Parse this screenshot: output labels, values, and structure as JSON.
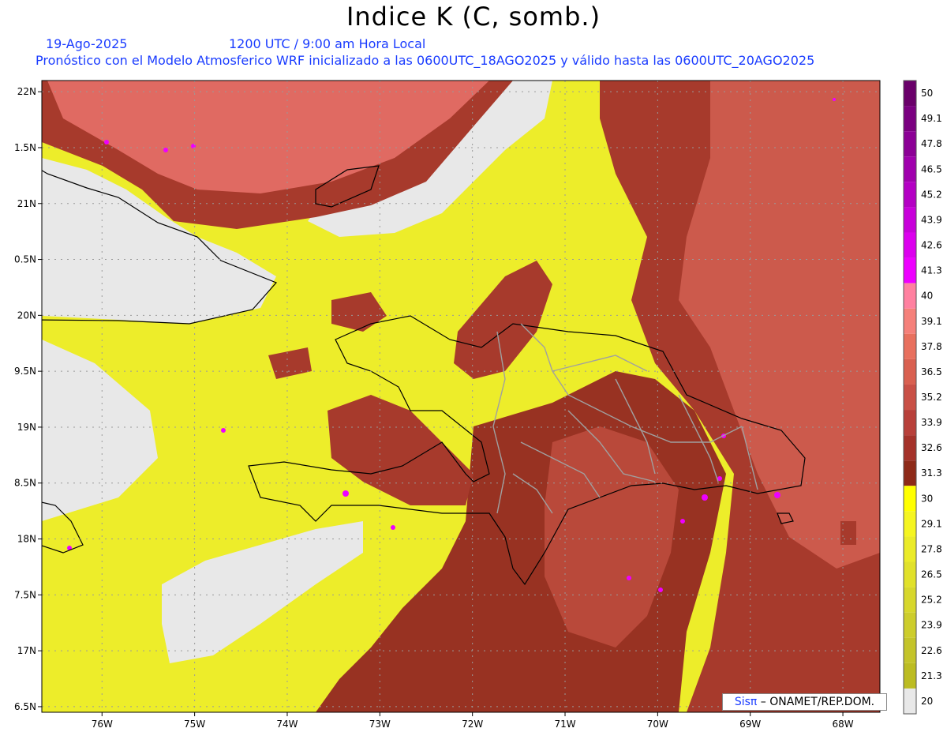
{
  "title": "Indice K (C, somb.)",
  "date": "19-Ago-2025",
  "time": "1200 UTC / 9:00 am Hora Local",
  "model_line": "Pronóstico con el Modelo Atmosferico WRF inicializado a las 0600UTC_18AGO2025 y válido hasta las  0600UTC_20AGO2025",
  "credit": {
    "brand": "Sisπ",
    "org": " – ONAMET/REP.DOM."
  },
  "map": {
    "lat_labels": [
      "22N",
      "1.5N",
      "21N",
      "0.5N",
      "20N",
      "9.5N",
      "19N",
      "8.5N",
      "18N",
      "7.5N",
      "17N",
      "6.5N"
    ],
    "lat_values": [
      22,
      21.5,
      21,
      20.5,
      20,
      19.5,
      19,
      18.5,
      18,
      17.5,
      17,
      16.5
    ],
    "lon_labels": [
      "76W",
      "75W",
      "74W",
      "73W",
      "72W",
      "71W",
      "70W",
      "69W",
      "68W"
    ],
    "lon_values": [
      -76,
      -75,
      -74,
      -73,
      -72,
      -71,
      -70,
      -69,
      -68
    ],
    "lon_range": [
      -76.65,
      -67.6
    ],
    "lat_range": [
      16.45,
      22.1
    ],
    "colors": {
      "land_masked": "#e8e8e8",
      "grid": "#9a9a9a",
      "coast": "#000000",
      "borders": "#a0a0a0"
    }
  },
  "colorbar": {
    "labels": [
      "50",
      "49.1",
      "47.8",
      "46.5",
      "45.2",
      "43.9",
      "42.6",
      "41.3",
      "40",
      "39.1",
      "37.8",
      "36.5",
      "35.2",
      "33.9",
      "32.6",
      "31.3",
      "30",
      "29.1",
      "27.8",
      "26.5",
      "25.2",
      "23.9",
      "22.6",
      "21.3",
      "20"
    ],
    "colors": [
      "#6a006a",
      "#7a0080",
      "#8c0096",
      "#a000ad",
      "#b400c4",
      "#c800da",
      "#dc00ee",
      "#ee00ff",
      "#ff80a0",
      "#f5807a",
      "#e8705e",
      "#d96050",
      "#c95046",
      "#b8403a",
      "#a5322a",
      "#8e2a18",
      "#ffff00",
      "#f5f520",
      "#ebeb28",
      "#e1e12a",
      "#d7d72c",
      "#cdcd2c",
      "#c4c42a",
      "#bcbc22",
      "#e8e8e8"
    ]
  }
}
